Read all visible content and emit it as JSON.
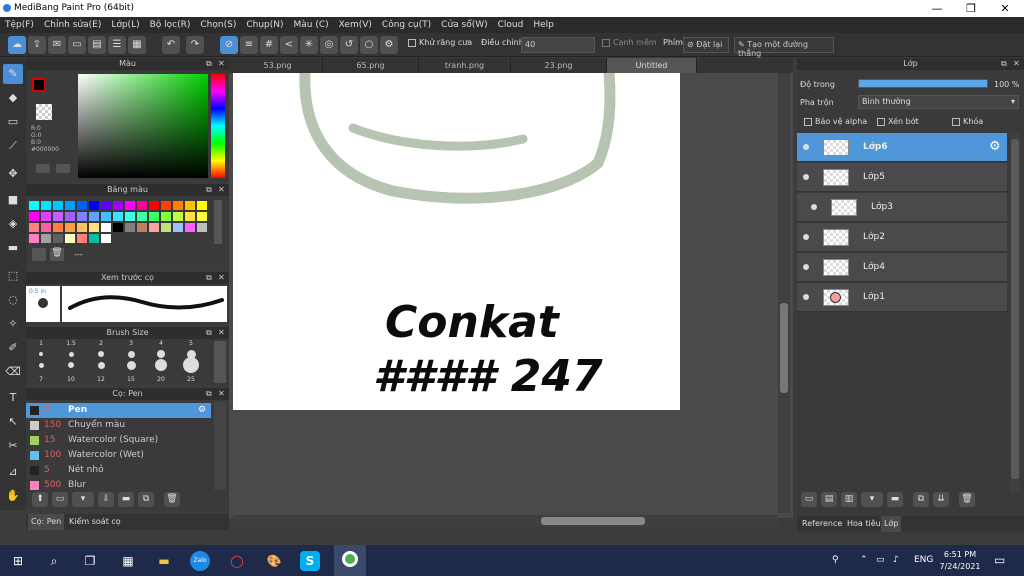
{
  "window": {
    "title": "MediBang Paint Pro (64bit)",
    "minimize": "—",
    "restore": "❐",
    "close": "✕"
  },
  "menu": [
    "Tệp(F)",
    "Chỉnh sửa(E)",
    "Lớp(L)",
    "Bộ lọc(R)",
    "Chọn(S)",
    "Chụp(N)",
    "Màu (C)",
    "Xem(V)",
    "Công cụ(T)",
    "Cửa sổ(W)",
    "Cloud",
    "Help"
  ],
  "toolbar": {
    "antialias_label": "Khử răng cưa",
    "adjust_label": "Điều chỉnh",
    "adjust_value": "40",
    "soft_edge_label": "Cạnh mềm",
    "key_label": "Phím",
    "reset_label": "Đặt lại",
    "straight_line_label": "Tạo một đường thẳng"
  },
  "color_panel": {
    "title": "Màu",
    "r": "R:0",
    "g": "G:0",
    "b": "B:0",
    "hex": "#000000"
  },
  "palette_panel": {
    "title": "Bảng màu",
    "extra": "---",
    "colors": [
      "#00ffff",
      "#00e5ff",
      "#00c8ff",
      "#00a0ff",
      "#0060ff",
      "#0000ff",
      "#6000ff",
      "#a000ff",
      "#ff00ff",
      "#ff0090",
      "#ff0000",
      "#ff4000",
      "#ff8000",
      "#ffc000",
      "#ffff00",
      "#ff00ff",
      "#e040ff",
      "#c060ff",
      "#a060ff",
      "#8080ff",
      "#60a0ff",
      "#40c0ff",
      "#40e0ff",
      "#40ffe0",
      "#40ffa0",
      "#40ff60",
      "#80ff40",
      "#c0ff40",
      "#ffe040",
      "#ffff40",
      "#ff8080",
      "#ff60a0",
      "#ff8040",
      "#ffa040",
      "#ffc060",
      "#ffe080",
      "#ffffff",
      "#000000",
      "#808080",
      "#c08060",
      "#ffa0a0",
      "#c0e080",
      "#a0c0ff",
      "#ff60ff",
      "#c0c0c0",
      "#ff80c0",
      "#a0a0a0",
      "#606060",
      "#ffffc0",
      "#ff8080",
      "#00c0a0",
      "#ffffff"
    ]
  },
  "preview_panel": {
    "title": "Xem trước cọ",
    "size_label": "0.5 in"
  },
  "brush_size_panel": {
    "title": "Brush Size",
    "top": [
      "1",
      "1.5",
      "2",
      "3",
      "4",
      "5"
    ],
    "bottom": [
      "7",
      "10",
      "12",
      "15",
      "20",
      "25"
    ]
  },
  "brush_panel": {
    "title": "Cọ: Pen",
    "items": [
      {
        "num": "7",
        "name": "Pen",
        "color": "#222222"
      },
      {
        "num": "150",
        "name": "Chuyển màu",
        "color": "#cccccc"
      },
      {
        "num": "15",
        "name": "Watercolor (Square)",
        "color": "#a0d060"
      },
      {
        "num": "100",
        "name": "Watercolor (Wet)",
        "color": "#60c0f0"
      },
      {
        "num": "5",
        "name": "Nét nhỏ",
        "color": "#222222"
      },
      {
        "num": "500",
        "name": "Blur",
        "color": "#ff80c0"
      }
    ]
  },
  "bottom_tabs": {
    "brush": "Cọ: Pen",
    "brush_ctrl": "Kiểm soát cọ"
  },
  "canvas_tabs": [
    "53.png",
    "65.png",
    "tranh.png",
    "23.png",
    "Untitled"
  ],
  "canvas_text": {
    "line1": "Conkat",
    "line2": "#### 247"
  },
  "layer_panel": {
    "title": "Lớp",
    "opacity_label": "Độ trong",
    "opacity_value": "100 %",
    "opacity_fraction": 1.0,
    "blend_label": "Pha trộn",
    "blend_value": "Bình thường",
    "protect_alpha": "Bảo vệ alpha",
    "clipping": "Xén bớt",
    "lock": "Khóa",
    "layers": [
      "Lớp6",
      "Lớp5",
      "Lớp3",
      "Lớp2",
      "Lớp4",
      "Lớp1"
    ],
    "tabs": [
      "Reference",
      "Hoa tiêu",
      "Lớp"
    ]
  },
  "taskbar": {
    "time": "6:51 PM",
    "date": "7/24/2021",
    "lang": "ENG"
  }
}
